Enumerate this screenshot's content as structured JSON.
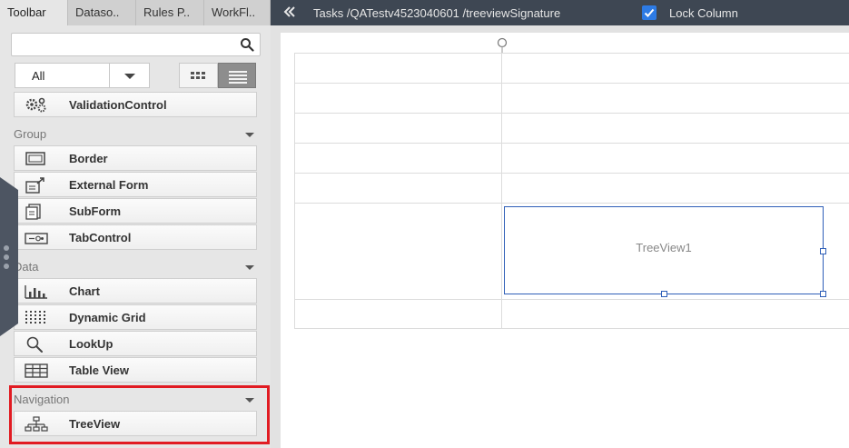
{
  "left_panel": {
    "tabs": [
      {
        "label": "Toolbar",
        "active": true
      },
      {
        "label": "Dataso..",
        "active": false
      },
      {
        "label": "Rules P..",
        "active": false
      },
      {
        "label": "WorkFl..",
        "active": false
      }
    ],
    "search": {
      "placeholder": "",
      "value": ""
    },
    "filter": {
      "selected": "All"
    },
    "top_item": {
      "label": "ValidationControl",
      "icon": "gears-icon"
    },
    "groups": [
      {
        "name": "Group",
        "items": [
          {
            "label": "Border",
            "icon": "border-icon"
          },
          {
            "label": "External Form",
            "icon": "external-form-icon"
          },
          {
            "label": "SubForm",
            "icon": "subform-icon"
          },
          {
            "label": "TabControl",
            "icon": "tabcontrol-icon"
          }
        ]
      },
      {
        "name": "Data",
        "items": [
          {
            "label": "Chart",
            "icon": "chart-icon"
          },
          {
            "label": "Dynamic Grid",
            "icon": "dynamic-grid-icon"
          },
          {
            "label": "LookUp",
            "icon": "magnifier-icon"
          },
          {
            "label": "Table View",
            "icon": "table-icon"
          }
        ]
      },
      {
        "name": "Navigation",
        "items": [
          {
            "label": "TreeView",
            "icon": "treeview-icon"
          }
        ]
      }
    ]
  },
  "topbar": {
    "breadcrumb": "Tasks /QATestv4523040601 /treeviewSignature",
    "lock_column_label": "Lock Column",
    "lock_column_checked": true
  },
  "canvas": {
    "control_label": "TreeView1"
  },
  "colors": {
    "topbar_bg": "#3e4753",
    "accent_blue": "#2d7be5",
    "highlight_red": "#e11b22",
    "selection_blue": "#2f5fb8"
  }
}
